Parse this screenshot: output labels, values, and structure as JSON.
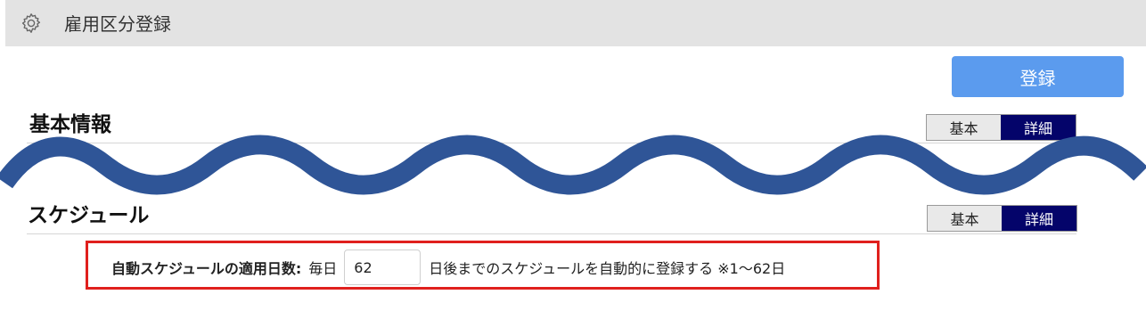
{
  "header": {
    "title": "雇用区分登録",
    "icon": "gear-icon"
  },
  "toolbar": {
    "register_label": "登録",
    "register_color": "#5b9bee"
  },
  "sections": {
    "basic_info": {
      "title": "基本情報",
      "toggle": {
        "basic": "基本",
        "detail": "詳細",
        "selected": "詳細"
      }
    },
    "schedule": {
      "title": "スケジュール",
      "toggle": {
        "basic": "基本",
        "detail": "詳細",
        "selected": "詳細"
      }
    }
  },
  "schedule_settings": {
    "label": "自動スケジュールの適用日数:",
    "prefix": "毎日",
    "value": "62",
    "suffix": "日後までのスケジュールを自動的に登録する ※1～62日"
  },
  "colors": {
    "accent": "#04046a",
    "highlight_border": "#e0201d",
    "wave": "#2f5597"
  }
}
